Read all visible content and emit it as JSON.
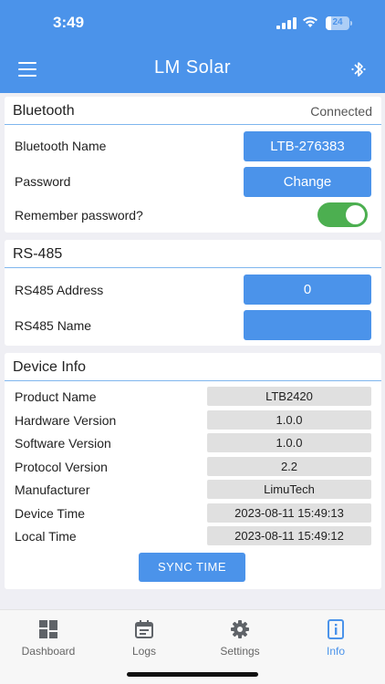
{
  "status_bar": {
    "time": "3:49",
    "battery": "24"
  },
  "header": {
    "title": "LM Solar",
    "menu_icon": "menu-icon",
    "bluetooth_icon": "bluetooth-icon"
  },
  "bluetooth": {
    "heading": "Bluetooth",
    "status": "Connected",
    "name_label": "Bluetooth Name",
    "name_value": "LTB-276383",
    "password_label": "Password",
    "password_button": "Change",
    "remember_label": "Remember password?",
    "remember_on": true
  },
  "rs485": {
    "heading": "RS-485",
    "address_label": "RS485 Address",
    "address_value": "0",
    "name_label": "RS485 Name",
    "name_value": ""
  },
  "device_info": {
    "heading": "Device Info",
    "rows": [
      {
        "label": "Product Name",
        "value": "LTB2420"
      },
      {
        "label": "Hardware Version",
        "value": "1.0.0"
      },
      {
        "label": "Software Version",
        "value": "1.0.0"
      },
      {
        "label": "Protocol Version",
        "value": "2.2"
      },
      {
        "label": "Manufacturer",
        "value": "LimuTech"
      },
      {
        "label": "Device Time",
        "value": "2023-08-11 15:49:13"
      },
      {
        "label": "Local Time",
        "value": "2023-08-11 15:49:12"
      }
    ],
    "sync_button": "SYNC TIME"
  },
  "tabs": [
    {
      "label": "Dashboard",
      "icon": "dashboard-icon"
    },
    {
      "label": "Logs",
      "icon": "logs-icon"
    },
    {
      "label": "Settings",
      "icon": "gear-icon"
    },
    {
      "label": "Info",
      "icon": "info-icon",
      "active": true
    }
  ],
  "colors": {
    "primary": "#4b93ea",
    "toggle_on": "#4caf50",
    "value_bg": "#e0e0e0"
  }
}
